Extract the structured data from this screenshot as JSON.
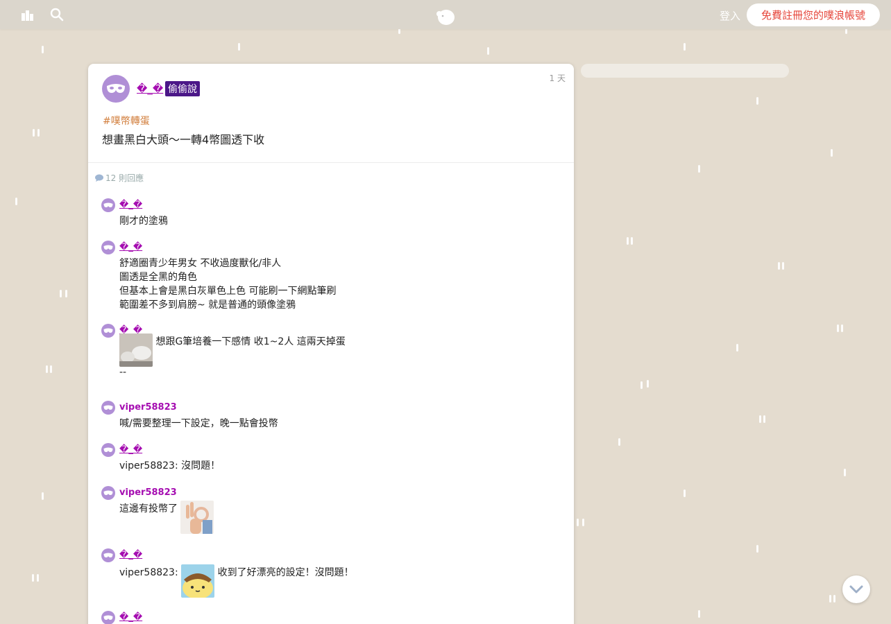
{
  "topbar": {
    "login_label": "登入",
    "signup_label": "免費註冊您的噗浪帳號"
  },
  "post": {
    "time": "1 天",
    "author": "�_�",
    "anon_badge": "偷偷說",
    "tag": "#噗幣轉蛋",
    "text": "想畫黑白大頭～一轉4幣圖透下收",
    "reply_count": "12 則回應"
  },
  "responses": [
    {
      "name": "�_�",
      "lines": [
        "剛才的塗鴉"
      ]
    },
    {
      "name": "�_�",
      "lines": [
        "舒適圈青少年男女 不收過度獸化/非人",
        "圖透是全黑的角色",
        "但基本上會是黑白灰單色上色 可能刷一下網點筆刷",
        "範圍差不多到肩膀~ 就是普通的頭像塗鴉"
      ]
    },
    {
      "name": "�_�",
      "text": "想跟G筆培養一下感情 收1~2人 這兩天掉蛋",
      "line2": "--"
    },
    {
      "name": "viper58823",
      "lines": [
        "喊/需要整理一下設定，晚一點會投幣"
      ]
    },
    {
      "name": "�_�",
      "lines": [
        "viper58823: 沒問題！"
      ]
    },
    {
      "name": "viper58823",
      "text": "這邊有投幣了"
    },
    {
      "name": "�_�",
      "prefix": "viper58823:",
      "suffix": "收到了好漂亮的設定！沒問題！"
    },
    {
      "name": "�_�"
    }
  ],
  "colors": {
    "background": "#e4dccf",
    "accent": "#a50db1",
    "signup_text": "#e6463b",
    "anon_badge": "#4b1788"
  }
}
